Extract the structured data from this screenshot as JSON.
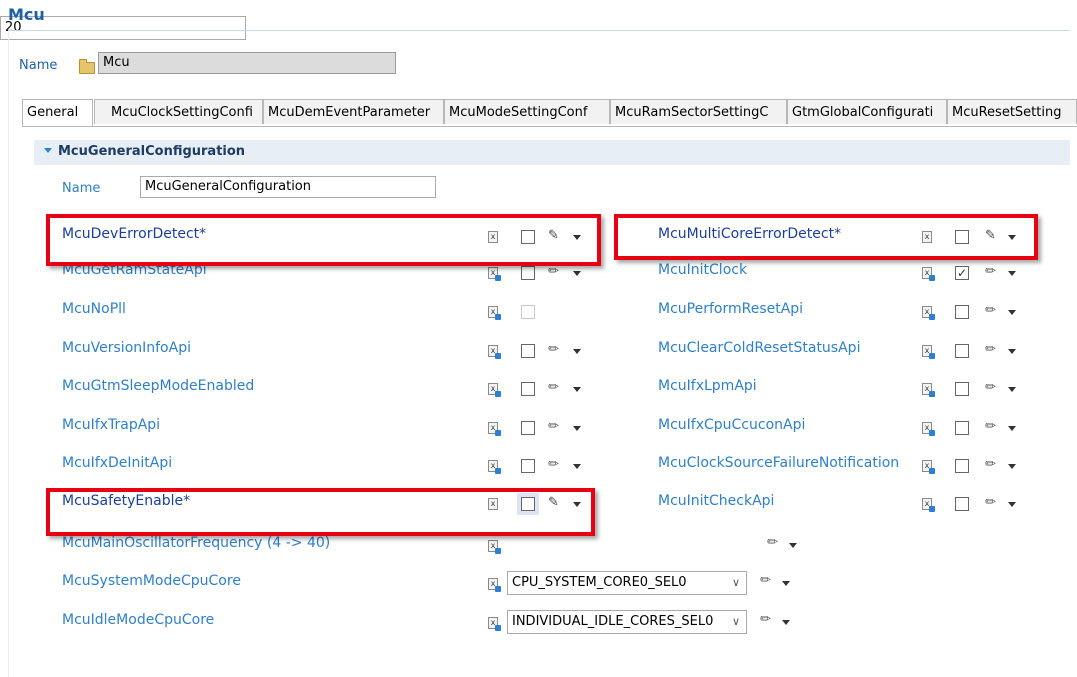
{
  "header": {
    "title": "Mcu"
  },
  "top_name": {
    "label": "Name",
    "value": "Mcu"
  },
  "tabs": [
    {
      "label": "General",
      "active": true
    },
    {
      "label": "McuClockSettingConfi"
    },
    {
      "label": "McuDemEventParameter"
    },
    {
      "label": "McuModeSettingConf"
    },
    {
      "label": "McuRamSectorSettingC"
    },
    {
      "label": "GtmGlobalConfigurati"
    },
    {
      "label": "McuResetSetting"
    }
  ],
  "section": {
    "title": "McuGeneralConfiguration",
    "name_label": "Name",
    "name_value": "McuGeneralConfiguration"
  },
  "params_left": [
    {
      "label": "McuDevErrorDetect*",
      "checked": false,
      "icon": "x-icon",
      "tool": "wrench-icon"
    },
    {
      "label": "McuGetRamStateApi",
      "checked": false,
      "icon": "xb-icon",
      "tool": "pencil-icon"
    },
    {
      "label": "McuNoPll",
      "checked": false,
      "icon": "xb-icon",
      "tool": "none"
    },
    {
      "label": "McuVersionInfoApi",
      "checked": false,
      "icon": "xb-icon",
      "tool": "pencil-icon"
    },
    {
      "label": "McuGtmSleepModeEnabled",
      "checked": false,
      "icon": "xb-icon",
      "tool": "pencil-icon"
    },
    {
      "label": "McuIfxTrapApi",
      "checked": false,
      "icon": "xb-icon",
      "tool": "pencil-icon"
    },
    {
      "label": "McuIfxDeInitApi",
      "checked": false,
      "icon": "xb-icon",
      "tool": "pencil-icon"
    },
    {
      "label": "McuSafetyEnable*",
      "checked": false,
      "icon": "x-icon",
      "tool": "wrench-icon"
    }
  ],
  "params_right": [
    {
      "label": "McuMultiCoreErrorDetect*",
      "checked": false,
      "icon": "x-icon",
      "tool": "wrench-icon"
    },
    {
      "label": "McuInitClock",
      "checked": true,
      "icon": "xb-icon",
      "tool": "pencil-icon"
    },
    {
      "label": "McuPerformResetApi",
      "checked": false,
      "icon": "xb-icon",
      "tool": "pencil-icon"
    },
    {
      "label": "McuClearColdResetStatusApi",
      "checked": false,
      "icon": "xb-icon",
      "tool": "pencil-icon"
    },
    {
      "label": "McuIfxLpmApi",
      "checked": false,
      "icon": "xb-icon",
      "tool": "pencil-icon"
    },
    {
      "label": "McuIfxCpuCcuconApi",
      "checked": false,
      "icon": "xb-icon",
      "tool": "pencil-icon"
    },
    {
      "label": "McuClockSourceFailureNotification",
      "checked": false,
      "icon": "xb-icon",
      "tool": "pencil-icon"
    },
    {
      "label": "McuInitCheckApi",
      "checked": false,
      "icon": "xb-icon",
      "tool": "pencil-icon"
    }
  ],
  "params_bottom": [
    {
      "label": "McuMainOscillatorFrequency (4 -> 40)",
      "value": "20",
      "kind": "text"
    },
    {
      "label": "McuSystemModeCpuCore",
      "value": "CPU_SYSTEM_CORE0_SEL0",
      "kind": "select"
    },
    {
      "label": "McuIdleModeCpuCore",
      "value": "INDIVIDUAL_IDLE_CORES_SEL0",
      "kind": "select"
    }
  ],
  "colors": {
    "accent": "#1f5fa8",
    "link": "#2f7fc9",
    "highlight_box": "#e60012"
  }
}
